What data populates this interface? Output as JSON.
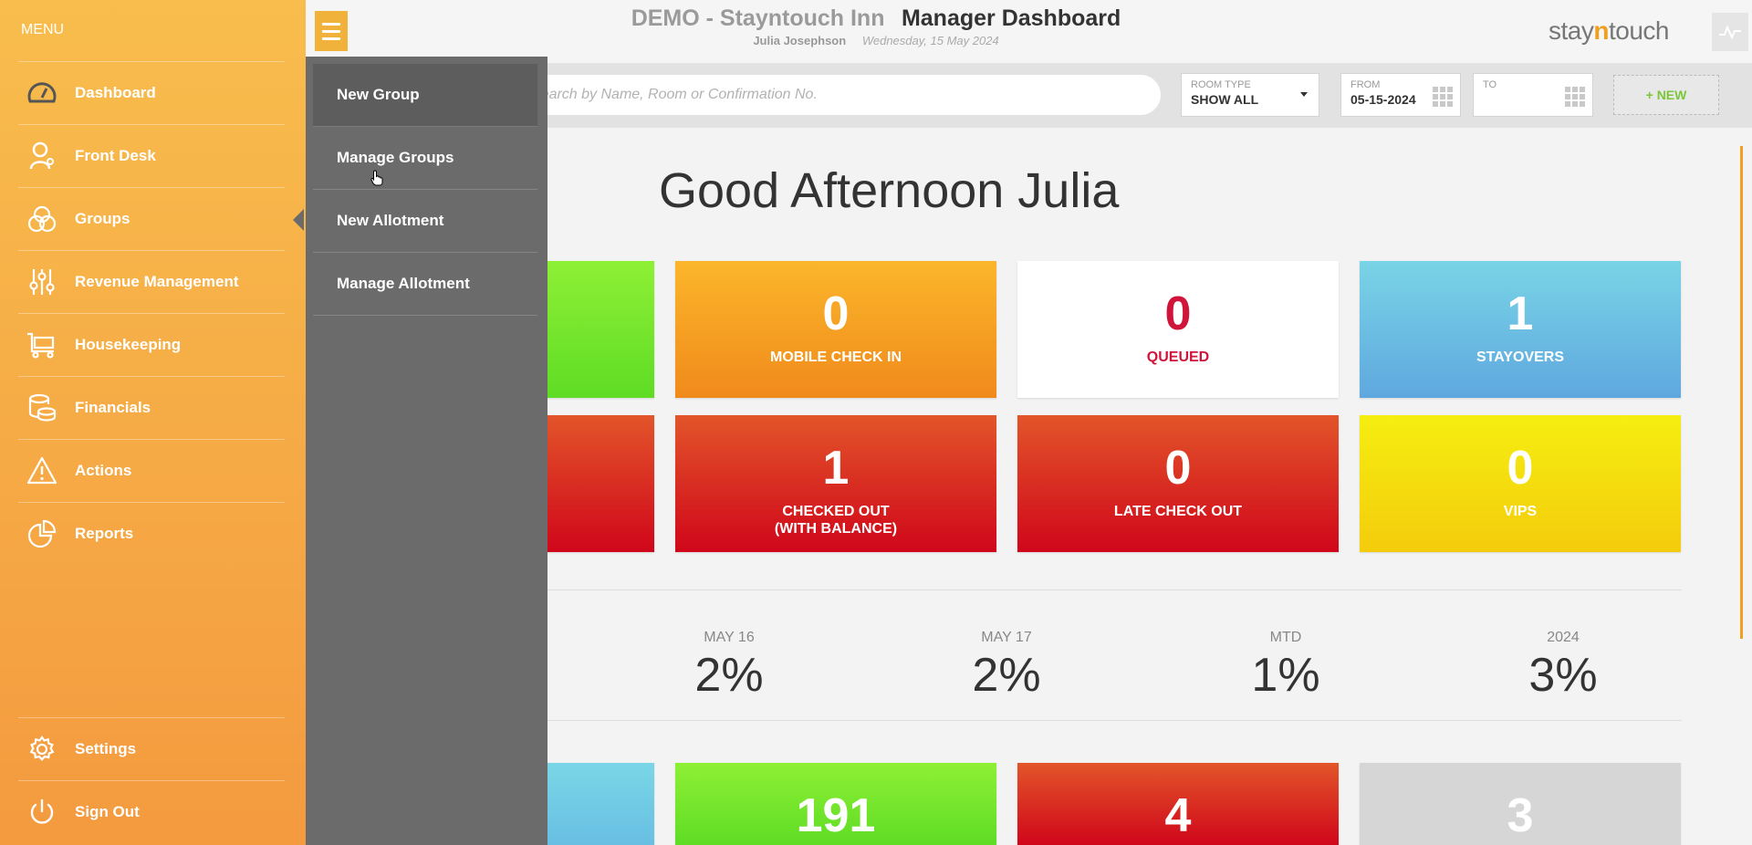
{
  "header": {
    "hotel_title": "DEMO - Stayntouch Inn",
    "dashboard_title": "Manager Dashboard",
    "user_name": "Julia Josephson",
    "date": "Wednesday, 15 May 2024",
    "logo_stay": "stay",
    "logo_n": "n",
    "logo_touch": "touch",
    "accent_color": "#f0a020"
  },
  "search": {
    "placeholder": "Search by Name, Room or Confirmation No.",
    "room_type_label": "ROOM TYPE",
    "room_type_value": "SHOW ALL",
    "from_label": "FROM",
    "from_value": "05-15-2024",
    "to_label": "TO",
    "to_value": "",
    "new_button": "+ NEW"
  },
  "menu": {
    "title": "MENU",
    "items": [
      {
        "label": "Dashboard",
        "icon": "gauge-icon"
      },
      {
        "label": "Front Desk",
        "icon": "key-person-icon"
      },
      {
        "label": "Groups",
        "icon": "groups-icon"
      },
      {
        "label": "Revenue Management",
        "icon": "sliders-icon"
      },
      {
        "label": "Housekeeping",
        "icon": "cart-icon"
      },
      {
        "label": "Financials",
        "icon": "coins-icon"
      },
      {
        "label": "Actions",
        "icon": "warning-icon"
      },
      {
        "label": "Reports",
        "icon": "pie-chart-icon"
      }
    ],
    "bottom_items": [
      {
        "label": "Settings",
        "icon": "gear-icon"
      },
      {
        "label": "Sign Out",
        "icon": "power-icon"
      }
    ]
  },
  "submenu": {
    "items": [
      {
        "label": "New Group"
      },
      {
        "label": "Manage Groups"
      },
      {
        "label": "New Allotment"
      },
      {
        "label": "Manage Allotment"
      }
    ]
  },
  "main": {
    "greeting": "Good Afternoon Julia",
    "tiles_row1": [
      {
        "value": "",
        "label": ""
      },
      {
        "value": "0",
        "label": "MOBILE CHECK IN"
      },
      {
        "value": "0",
        "label": "QUEUED"
      },
      {
        "value": "1",
        "label": "STAYOVERS"
      }
    ],
    "tiles_row2": [
      {
        "value": "",
        "label": ""
      },
      {
        "value": "1",
        "label": "CHECKED OUT\n(WITH BALANCE)"
      },
      {
        "value": "0",
        "label": "LATE CHECK OUT"
      },
      {
        "value": "0",
        "label": "VIPS"
      }
    ],
    "stats": [
      {
        "label": "MAY 16",
        "value": "2%"
      },
      {
        "label": "MAY 17",
        "value": "2%"
      },
      {
        "label": "MTD",
        "value": "1%"
      },
      {
        "label": "2024",
        "value": "3%"
      }
    ],
    "tiles_row3": [
      {
        "value": ""
      },
      {
        "value": "191"
      },
      {
        "value": "4"
      },
      {
        "value": "3"
      }
    ]
  }
}
